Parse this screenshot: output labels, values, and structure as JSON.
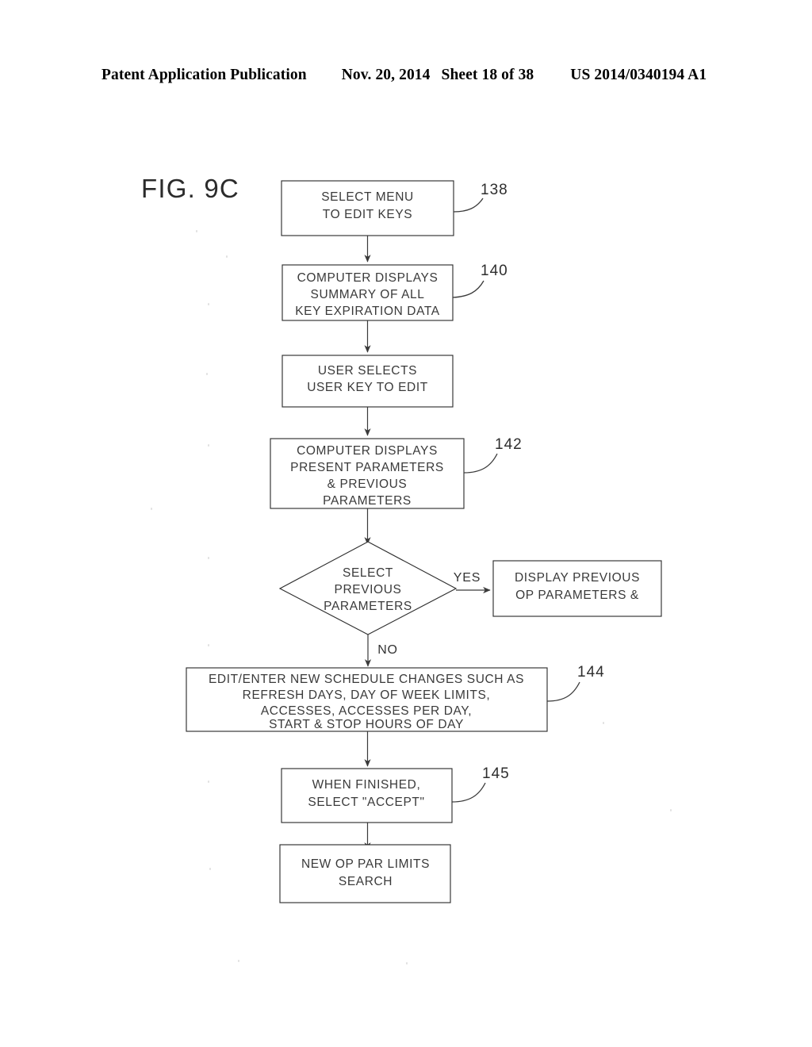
{
  "header": {
    "publication": "Patent Application Publication",
    "date": "Nov. 20, 2014",
    "sheet": "Sheet 18 of 38",
    "patent_number": "US 2014/0340194 A1"
  },
  "figure": {
    "label": "FIG. 9C"
  },
  "flowchart": {
    "nodes": [
      {
        "id": "n138",
        "shape": "rect",
        "ref": "138",
        "lines": [
          "SELECT MENU",
          "TO EDIT KEYS"
        ]
      },
      {
        "id": "n140",
        "shape": "rect",
        "ref": "140",
        "lines": [
          "COMPUTER DISPLAYS",
          "SUMMARY OF ALL",
          "KEY EXPIRATION DATA"
        ]
      },
      {
        "id": "n_user_selects",
        "shape": "rect",
        "ref": "",
        "lines": [
          "USER SELECTS",
          "USER KEY TO EDIT"
        ]
      },
      {
        "id": "n142",
        "shape": "rect",
        "ref": "142",
        "lines": [
          "COMPUTER DISPLAYS",
          "PRESENT PARAMETERS",
          "& PREVIOUS",
          "PARAMETERS"
        ]
      },
      {
        "id": "n_decision",
        "shape": "diamond",
        "ref": "",
        "lines": [
          "SELECT",
          "PREVIOUS",
          "PARAMETERS"
        ]
      },
      {
        "id": "n_display_prev",
        "shape": "rect",
        "ref": "",
        "lines": [
          "DISPLAY PREVIOUS",
          "OP PARAMETERS &"
        ]
      },
      {
        "id": "n144",
        "shape": "rect",
        "ref": "144",
        "lines": [
          "EDIT/ENTER NEW SCHEDULE CHANGES SUCH AS",
          "REFRESH DAYS, DAY OF WEEK LIMITS,",
          "ACCESSES, ACCESSES PER DAY,",
          "START & STOP HOURS OF DAY"
        ]
      },
      {
        "id": "n145",
        "shape": "rect",
        "ref": "145",
        "lines": [
          "WHEN FINISHED,",
          "SELECT \"ACCEPT\""
        ]
      },
      {
        "id": "n_new_op",
        "shape": "rect",
        "ref": "",
        "lines": [
          "NEW OP PAR LIMITS",
          "SEARCH"
        ]
      }
    ],
    "branch_labels": {
      "yes": "YES",
      "no": "NO"
    }
  },
  "colors": {
    "ink": "#2f2f2f",
    "text": "#3a3a3a",
    "background": "#ffffff"
  }
}
